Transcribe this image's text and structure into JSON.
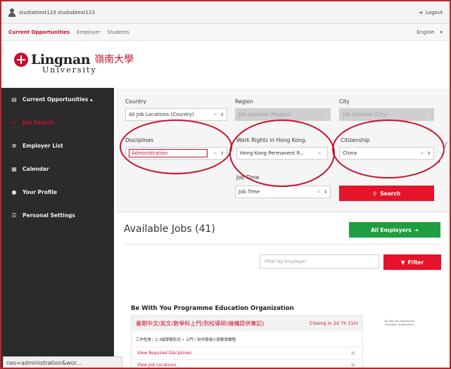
{
  "topbar": {
    "username": "studiabtest123 studiabtest123",
    "logout": "Logout"
  },
  "nav": {
    "items": [
      "Current Opportunities",
      "Employer",
      "Students"
    ],
    "active_index": 0,
    "language": "English",
    "language_arrow": "▾"
  },
  "logo": {
    "text": "Lingnan",
    "chinese": "嶺南大學",
    "sub": "University"
  },
  "sidebar": {
    "items": [
      {
        "icon": "▤",
        "icon_name": "document-icon",
        "label": "Current Opportunities ▴",
        "active": false
      },
      {
        "icon": "⌕",
        "icon_name": "search-icon",
        "label": "Job Search",
        "active": true
      },
      {
        "icon": "≡",
        "icon_name": "list-icon",
        "label": "Employer List",
        "active": false
      },
      {
        "icon": "▦",
        "icon_name": "calendar-icon",
        "label": "Calendar",
        "active": false
      },
      {
        "icon": "●",
        "icon_name": "users-icon",
        "label": "Your Profile",
        "active": false
      },
      {
        "icon": "☰",
        "icon_name": "settings-icon",
        "label": "Personal Settings",
        "active": false
      }
    ]
  },
  "filters": {
    "country": {
      "label": "Country",
      "value": "All Job Locations (Country)"
    },
    "region": {
      "label": "Region",
      "value": "Job Location (Region)"
    },
    "city": {
      "label": "City",
      "value": "Job Location (City)"
    },
    "disciplines": {
      "label": "Disciplines",
      "value": "Administration"
    },
    "work_rights": {
      "label": "Work Rights in Hong Kong.",
      "value": "Hong Kong Permanent R..."
    },
    "citizenship": {
      "label": "Citizenship",
      "value": "China"
    },
    "job_time": {
      "label": "Job Time",
      "value": "Job Time"
    },
    "clear_glyph": "×",
    "arrow_glyph": "⇕",
    "search_label": "Search",
    "search_icon": "⚲"
  },
  "results": {
    "title": "Available Jobs (41)",
    "all_employers": "All Employers",
    "all_employers_arrow": "➔",
    "filter_placeholder": "Filter by Employer",
    "filter_label": "Filter",
    "filter_icon": "▼"
  },
  "job": {
    "organization": "Be With You Programme Education Organization",
    "title": "暑期中文/英文/數學科上門/到校導師(機構提供筆記)",
    "closing": "Closing in 2d 7h 11m",
    "description": "工作性質：1-3個學期形式 • 上門 / 到中學或小學教學課程",
    "links": [
      "View Required Disciplines",
      "View Job Locations"
    ],
    "link_icon": "▤",
    "employer_logo_text": "Be With You Programme Education Organization"
  },
  "statusbar": {
    "url": "nes=administration&wor..."
  }
}
